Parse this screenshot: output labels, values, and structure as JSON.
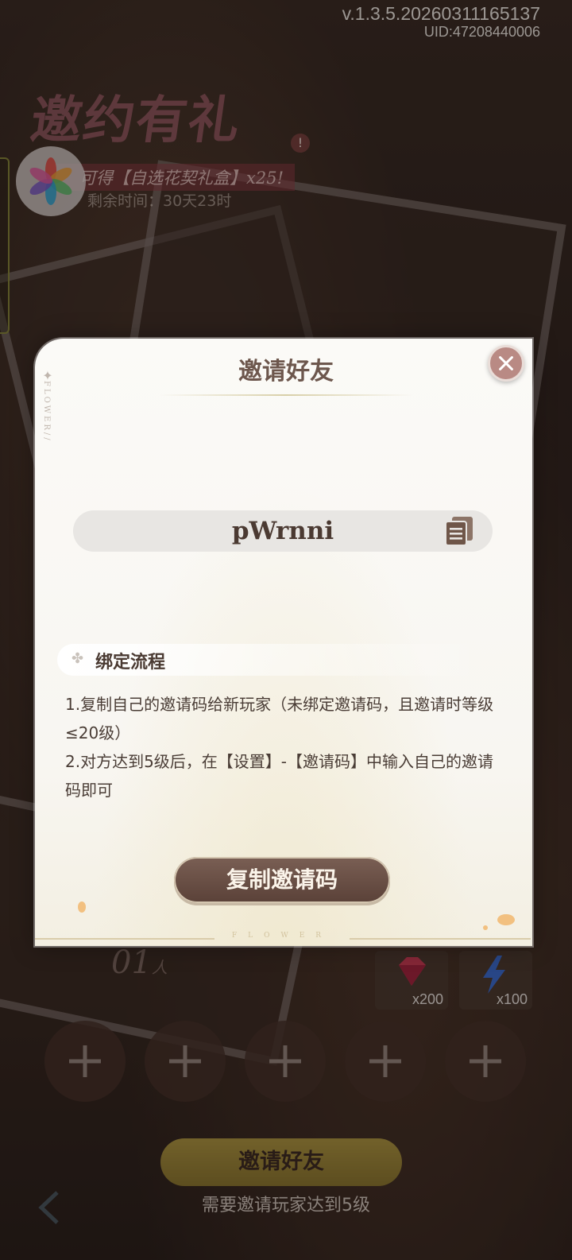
{
  "version": "v.1.3.5.20260311165137",
  "uid": "UID:47208440006",
  "event": {
    "title": "邀约有礼",
    "subtitle": "可得【自选花契礼盒】x25!",
    "time_label": "剩余时间：30天23时"
  },
  "modal": {
    "title": "邀请好友",
    "side_text": "FLOWER//",
    "invite_code": "pWrnni",
    "section_title": "绑定流程",
    "step1": "1.复制自己的邀请码给新玩家（未绑定邀请码，且邀请时等级≤20级）",
    "step2": " 2.对方达到5级后，在【设置】-【邀请码】中输入自己的邀请码即可",
    "copy_button": "复制邀请码",
    "footer_word": "FLOWER"
  },
  "background": {
    "count_value": "01",
    "count_unit": "人",
    "rewards": [
      {
        "icon": "gem-icon",
        "count": "x200"
      },
      {
        "icon": "lightning-icon",
        "count": "x100"
      }
    ],
    "slots": 5,
    "invite_button": "邀请好友",
    "note": "需要邀请玩家达到5级"
  },
  "colors": {
    "modal_bg": "#f8f6f1",
    "title": "#6d574d",
    "button": "#5a4138",
    "close": "#b98a84",
    "accent_gold": "#b29a42"
  }
}
